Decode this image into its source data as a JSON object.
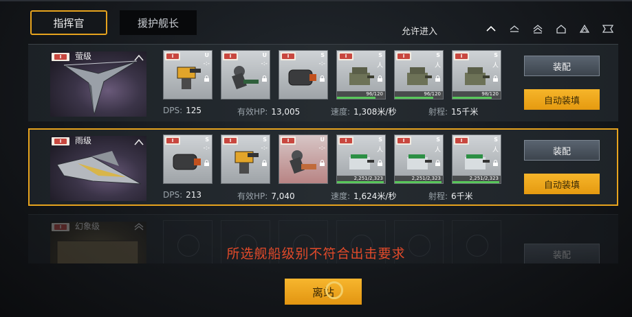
{
  "tabs": [
    {
      "label": "指挥官",
      "active": true
    },
    {
      "label": "援护舰长",
      "active": false
    }
  ],
  "allow_entry_label": "允许进入",
  "filter_icons": [
    "chevron-up-icon",
    "hull-class-2-icon",
    "hull-class-3-icon",
    "hull-class-4-icon",
    "hull-class-5-icon",
    "hull-class-6-icon"
  ],
  "tier_label": "I",
  "ships": [
    {
      "class_name": "萤级",
      "selected": false,
      "disabled": false,
      "modules": [
        {
          "slot": "U",
          "sub": "-:-",
          "art": "turret-yellow",
          "durability": null
        },
        {
          "slot": "U",
          "sub": "-:-",
          "art": "arm-green",
          "durability": null
        },
        {
          "slot": "S",
          "sub": "-:-",
          "art": "cannon-dark",
          "durability": null
        },
        {
          "slot": "S",
          "sub": "人",
          "art": "gun-olive",
          "durability": "96/120",
          "fill": 0.8
        },
        {
          "slot": "S",
          "sub": "人",
          "art": "gun-olive",
          "durability": "96/120",
          "fill": 0.8
        },
        {
          "slot": "S",
          "sub": "人",
          "art": "gun-olive",
          "durability": "98/120",
          "fill": 0.82
        }
      ],
      "stats": {
        "dps_label": "DPS:",
        "dps": "125",
        "hp_label": "有效HP:",
        "hp": "13,005",
        "speed_label": "速度:",
        "speed": "1,308米/秒",
        "range_label": "射程:",
        "range": "15千米"
      },
      "equip_label": "装配",
      "auto_label": "自动装填"
    },
    {
      "class_name": "雨级",
      "selected": true,
      "disabled": false,
      "modules": [
        {
          "slot": "S",
          "sub": "-:-",
          "art": "cannon-dark",
          "durability": null
        },
        {
          "slot": "S",
          "sub": "-:-",
          "art": "turret-yellow",
          "durability": null
        },
        {
          "slot": "U",
          "sub": "-:-",
          "art": "arm-red",
          "durability": null
        },
        {
          "slot": "S",
          "sub": "人",
          "art": "gun-green",
          "durability": "2,251/2,323",
          "fill": 0.97
        },
        {
          "slot": "S",
          "sub": "人",
          "art": "gun-green",
          "durability": "2,251/2,323",
          "fill": 0.97
        },
        {
          "slot": "S",
          "sub": "人",
          "art": "gun-green",
          "durability": "2,251/2,323",
          "fill": 0.97
        }
      ],
      "stats": {
        "dps_label": "DPS:",
        "dps": "213",
        "hp_label": "有效HP:",
        "hp": "7,040",
        "speed_label": "速度:",
        "speed": "1,624米/秒",
        "range_label": "射程:",
        "range": "6千米"
      },
      "equip_label": "装配",
      "auto_label": "自动装填"
    },
    {
      "class_name": "幻象级",
      "selected": false,
      "disabled": true,
      "equip_label": "装配"
    }
  ],
  "warning_text": "所选舰船级别不符合出击要求",
  "depart_label": "离站",
  "colors": {
    "accent": "#e8a41e",
    "warning": "#e24a2a",
    "durability": "#58c75a"
  }
}
